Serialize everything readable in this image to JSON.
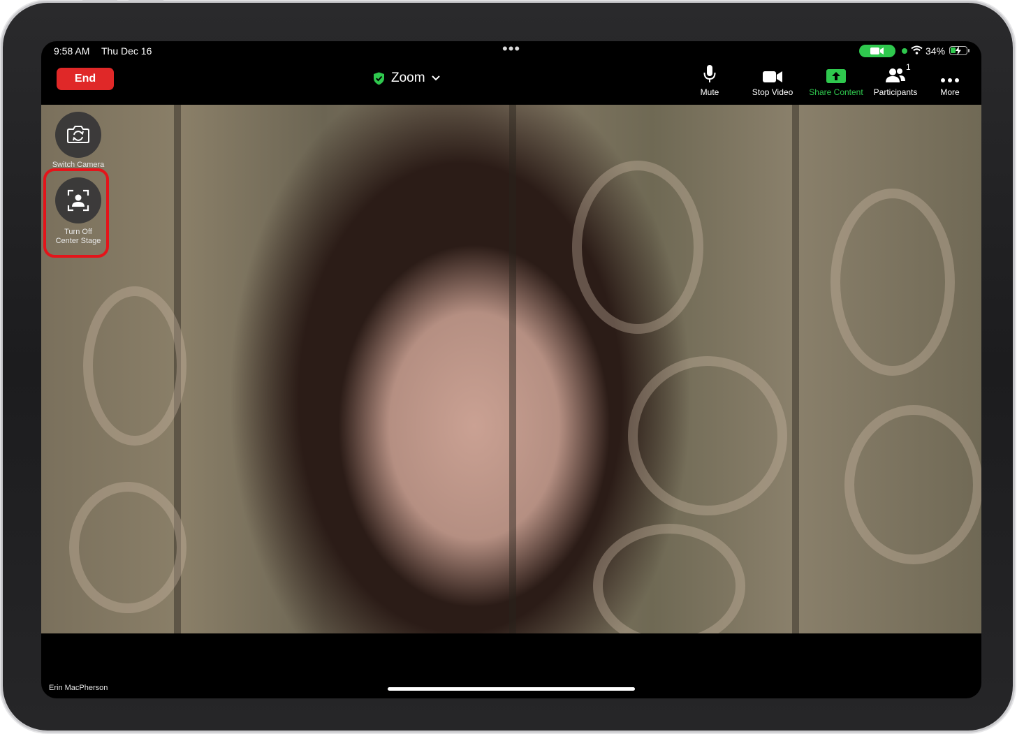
{
  "status_bar": {
    "time": "9:58 AM",
    "date": "Thu Dec 16",
    "battery_percent": "34%",
    "battery_level": 0.34
  },
  "toolbar": {
    "end_label": "End",
    "meeting_title": "Zoom",
    "mute_label": "Mute",
    "stop_video_label": "Stop Video",
    "share_content_label": "Share Content",
    "participants_label": "Participants",
    "participants_count": "1",
    "more_label": "More"
  },
  "side_controls": {
    "switch_camera_label": "Switch Camera",
    "center_stage_label_line1": "Turn Off",
    "center_stage_label_line2": "Center Stage"
  },
  "video": {
    "participant_name": "Erin MacPherson"
  },
  "colors": {
    "end_button": "#e02828",
    "accent_green": "#2fc84e",
    "highlight_red": "#e4141a"
  }
}
